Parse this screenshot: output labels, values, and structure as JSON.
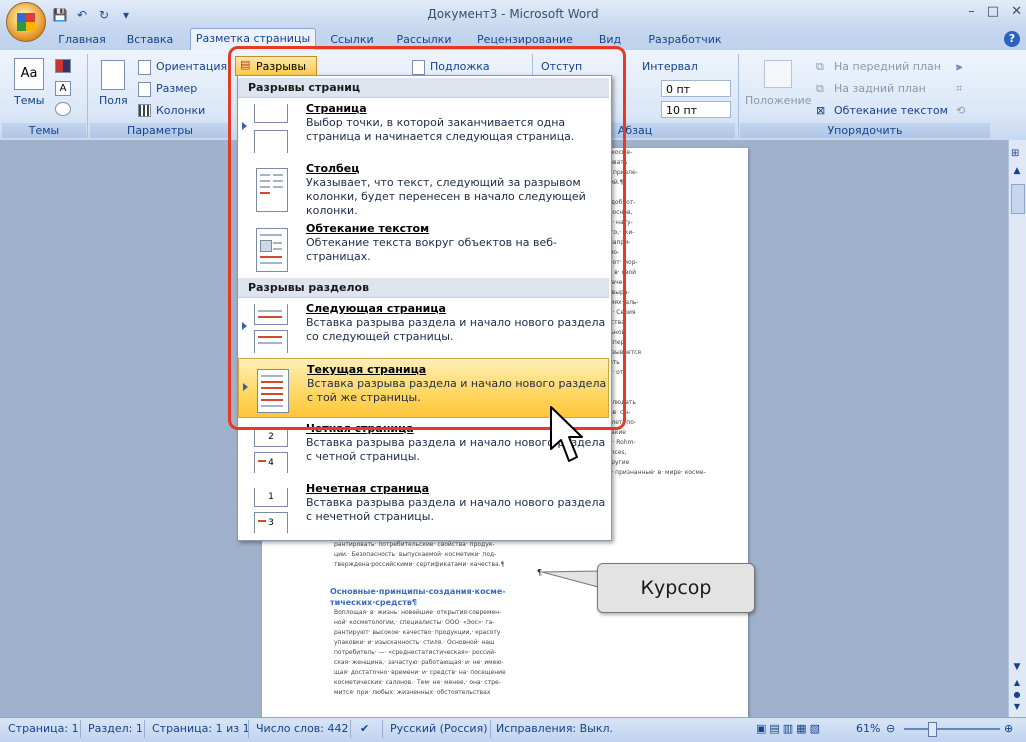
{
  "window": {
    "title": "Документ3 - Microsoft Word",
    "controls": [
      "–",
      "□",
      "✕"
    ]
  },
  "tabs": [
    {
      "label": "Главная"
    },
    {
      "label": "Вставка"
    },
    {
      "label": "Разметка страницы",
      "active": true
    },
    {
      "label": "Ссылки"
    },
    {
      "label": "Рассылки"
    },
    {
      "label": "Рецензирование"
    },
    {
      "label": "Вид"
    },
    {
      "label": "Разработчик"
    }
  ],
  "ribbon": {
    "themes": {
      "button": "Темы",
      "group": "Темы"
    },
    "page_setup": {
      "fields": "Поля",
      "orientation": "Ориентация",
      "size": "Размер",
      "columns": "Колонки",
      "breaks": "Разрывы",
      "group": "Параметры"
    },
    "background": {
      "watermark": "Подложка"
    },
    "paragraph": {
      "indent": "Отступ",
      "spacing": "Интервал",
      "before": "0 пт",
      "after": "10 пт",
      "group": "Абзац"
    },
    "arrange": {
      "position": "Положение",
      "bring_front": "На передний план",
      "send_back": "На задний план",
      "wrap_text": "Обтекание текстом",
      "group": "Упорядочить"
    }
  },
  "menu": {
    "page_breaks_header": "Разрывы страниц",
    "section_breaks_header": "Разрывы разделов",
    "items": [
      {
        "title": "Страница",
        "desc": "Выбор точки, в которой заканчивается одна страница и начинается следующая страница."
      },
      {
        "title": "Столбец",
        "desc": "Указывает, что текст, следующий за разрывом колонки, будет перенесен в начало следующей колонки."
      },
      {
        "title": "Обтекание текстом",
        "desc": "Обтекание текста вокруг объектов на веб-страницах."
      },
      {
        "title": "Следующая страница",
        "desc": "Вставка разрыва раздела и начало нового раздела со следующей страницы."
      },
      {
        "title": "Текущая страница",
        "desc": "Вставка разрыва раздела и начало нового раздела с той же страницы.",
        "highlighted": true
      },
      {
        "title": "Четная страница",
        "desc": "Вставка разрыва раздела и начало нового раздела с четной страницы."
      },
      {
        "title": "Нечетная страница",
        "desc": "Вставка разрыва раздела и начало нового раздела с нечетной страницы."
      }
    ]
  },
  "document": {
    "heading": "Основные·принципы·создания·косме-тических·средств¶",
    "left_lines": [
      "рантировать· потребительские· свойства· продук-",
      "ции.· Безопасность· выпускаемой· косметики· под-",
      "тверждена·российскими· сертификатами· качества.¶"
    ],
    "left_para2": [
      "Воплощая· в· жизнь· новейшие· открытия·современ-",
      "ной· косметологии,· специалисты· ООО· «Эос»· га-",
      "рантируют· высокое· качество· продукции,· красоту",
      "упаковки· и· изысканность· стиля.· Основной· наш",
      "потребитель· —· «среднестатистическая»· россий-",
      "ская· женщина,· зачастую· работающая· и· не· имею-",
      "щая· достаточно· времени· и· средств· на· посещение",
      "косметических· салонов.· Тем· не· менее,· она· стре-",
      "мится· при· любых· жизненных· обстоятельствах"
    ],
    "right_lines": [
      "достигнуть·желаемого·косме-",
      "недостаточно· использовать",
      "средства,· необходимо· привле-",
      "олленных· наукой·знаний.¶",
      "",
      "О· «Эос»· гарантирует· доброт-",
      "в· используемых· нами· основ,",
      "качество· применяемых· нату-",
      "будь· они· растительного,· жи-",
      "происхождения.· Так,· напри-",
      "(на· для· ванн,· кремнийо-",
      "айского· дерева,· крем· от· мор-",
      "бинь· и· др.)· включают· в· свой",
      "только· высочайшего· каче-",
      "растительного· сырья,· выра-",
      "мически· чистых· условиях· аль-",
      "дирских· заповедников.· Серия",
      "волос· и· моющие· средства",
      "на· на· основе· натуральной",
      "высокого· качества· и· «пер-",
      "словно,· этот· факт· сказывается",
      "позволяет· гарантировать",
      "косметический· эффект· от-",
      "¶",
      "",
      "сти· мы· стремимся· соблюдать",
      "бора· фирм-поставщиков· сы-",
      "В· течение· последних· лет· по-",
      "для· «Эос»· являются· такие",
      "Vackler,· Dragoon,· BASF,· Rohm-",
      "Bell· Flavors· and· Fragrances,",
      "Products· (Япония),· и· другие",
      "всемирно· известные· и· признанные· в· мире· косме-",
      "тики·компании.¶"
    ],
    "cursor_mark": "¶"
  },
  "callout": {
    "text": "Курсор"
  },
  "status_bar": {
    "page": "Страница: 1",
    "section": "Раздел: 1",
    "pages": "Страница: 1 из 1",
    "words": "Число слов: 442",
    "language": "Русский (Россия)",
    "track": "Исправления: Выкл.",
    "zoom": "61%"
  },
  "colors": {
    "accent_red": "#e63a24",
    "highlight": "#ffd661",
    "ribbon_text": "#15428b"
  }
}
